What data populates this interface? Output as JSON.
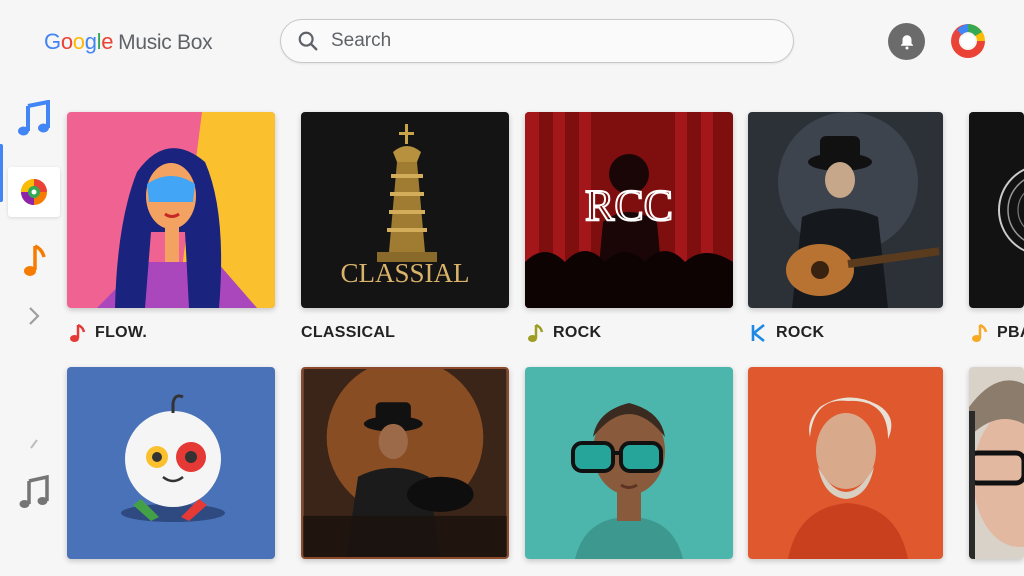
{
  "header": {
    "logo_google": [
      "G",
      "o",
      "o",
      "g",
      "l",
      "e"
    ],
    "logo_product": "Music Box",
    "search_placeholder": "Search",
    "notifications_icon": "bell-icon",
    "account_icon": "account-avatar-icon"
  },
  "sidebar": {
    "items": [
      {
        "name": "music-note-icon",
        "color": "#4285f4"
      },
      {
        "name": "colorful-disc-icon",
        "active": true
      },
      {
        "name": "music-note-icon",
        "color": "#f57c00"
      },
      {
        "name": "chevron-right-icon"
      },
      {
        "name": "slash-icon"
      },
      {
        "name": "music-note-icon",
        "color": "#757575"
      }
    ]
  },
  "row1": [
    {
      "label": "FLOW.",
      "icon": "music-note-icon",
      "icon_color": "#e53935"
    },
    {
      "label": "CLASSICAL",
      "art_text": "CLASSIAL"
    },
    {
      "label": "ROCK",
      "icon": "music-note-icon",
      "icon_color": "#9e9d24",
      "art_text": "RCC"
    },
    {
      "label": "ROCK",
      "icon": "k-logo-icon",
      "icon_color": "#1e88e5"
    },
    {
      "label": "PBA",
      "icon": "music-note-icon",
      "icon_color": "#f9a825"
    }
  ],
  "row2": [
    {
      "label": ""
    },
    {
      "label": ""
    },
    {
      "label": ""
    },
    {
      "label": ""
    },
    {
      "label": ""
    }
  ]
}
